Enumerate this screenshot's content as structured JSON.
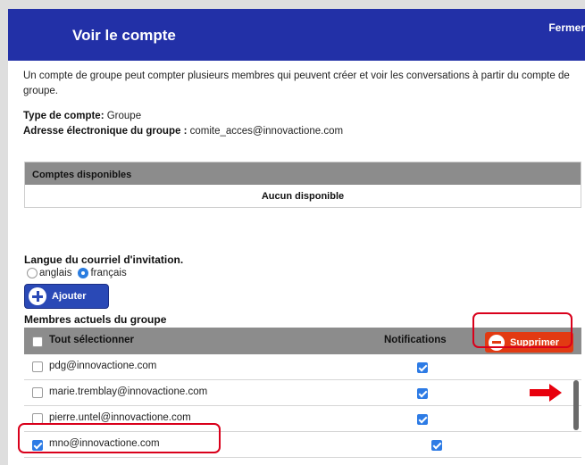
{
  "dialog": {
    "title": "Voir le compte",
    "close_label": "Fermer",
    "header_color": "#2230a7"
  },
  "intro_text": "Un compte de groupe peut compter plusieurs membres qui peuvent créer et voir les conversations à partir du compte de groupe.",
  "account": {
    "type_label": "Type de compte:",
    "type_value": "Groupe",
    "email_label": "Adresse électronique du groupe :",
    "email_value": "comite_acces@innovactione.com"
  },
  "available_accounts": {
    "header": "Comptes disponibles",
    "empty_text": "Aucun disponible"
  },
  "invitation_language": {
    "title": "Langue du courriel d'invitation.",
    "options": [
      "anglais",
      "français"
    ],
    "selected": "français"
  },
  "add_button_label": "Ajouter",
  "members": {
    "title": "Membres actuels du groupe",
    "select_all_label": "Tout sélectionner",
    "notifications_header": "Notifications",
    "delete_button_label": "Supprimer",
    "rows": [
      {
        "email": "pdg@innovactione.com",
        "selected": false,
        "notifications": true
      },
      {
        "email": "marie.tremblay@innovactione.com",
        "selected": false,
        "notifications": true
      },
      {
        "email": "pierre.untel@innovactione.com",
        "selected": false,
        "notifications": true
      },
      {
        "email": "mno@innovactione.com",
        "selected": true,
        "notifications": true
      }
    ]
  },
  "colors": {
    "accent_blue": "#2a49b6",
    "delete_red": "#e23a12",
    "highlight_red": "#d9001b"
  }
}
